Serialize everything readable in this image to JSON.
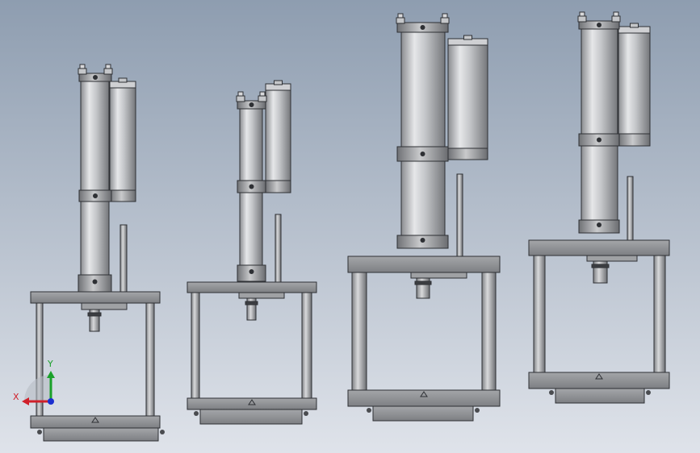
{
  "viewport": {
    "background_top": "#8e9db0",
    "background_bottom": "#dfe3ea"
  },
  "models": [
    {
      "id": "press-1"
    },
    {
      "id": "press-2"
    },
    {
      "id": "press-3"
    },
    {
      "id": "press-4"
    }
  ],
  "triad": {
    "x_label": "X",
    "y_label": "Y",
    "x_color": "#d0202a",
    "y_color": "#1aa12a",
    "z_color": "#1c2fd0"
  }
}
